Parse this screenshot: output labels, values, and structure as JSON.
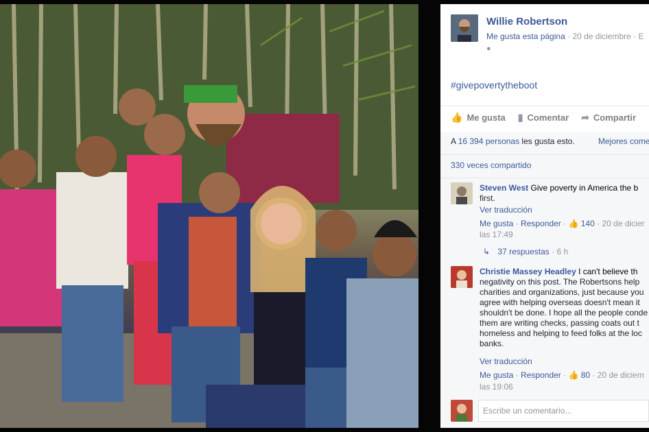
{
  "post": {
    "page_name": "Willie Robertson",
    "like_page": "Me gusta esta página",
    "date": "20 de diciembre",
    "date_tail": "· E",
    "hashtag": "#givepovertytheboot",
    "globe_icon": "globe-icon"
  },
  "actions": {
    "like": "Me gusta",
    "comment": "Comentar",
    "share": "Compartir"
  },
  "stats": {
    "likes_prefix": "A ",
    "likes_count": "16 394 personas",
    "likes_suffix": " les gusta esto.",
    "best_comments": "Mejores come",
    "shares": "330 veces compartido"
  },
  "comments": [
    {
      "author": "Steven West",
      "text": "Give poverty in America the b",
      "text_cont": "first.",
      "translate": "Ver traducción",
      "like": "Me gusta",
      "reply": "Responder",
      "like_count": "140",
      "date": "20 de dicier",
      "time": "las 17:49",
      "replies": "37 respuestas",
      "replies_age": "6 h"
    },
    {
      "author": "Christie Massey Headley",
      "text": "I can't believe th",
      "lines": [
        "negativity on this post. The Robertsons help",
        "charities and organizations, just because you",
        "agree with helping overseas doesn't mean it",
        "shouldn't be done. I hope all the people conde",
        "them are writing checks, passing coats out t",
        "homeless and helping to feed folks at the loc",
        "banks."
      ],
      "translate": "Ver traducción",
      "like": "Me gusta",
      "reply": "Responder",
      "like_count": "80",
      "date": "20 de diciem",
      "time": "las 19:06"
    }
  ],
  "comment_input": {
    "placeholder": "Escribe un comentario..."
  },
  "colors": {
    "link": "#3b5998",
    "meta": "#90949c",
    "background": "#050505"
  }
}
